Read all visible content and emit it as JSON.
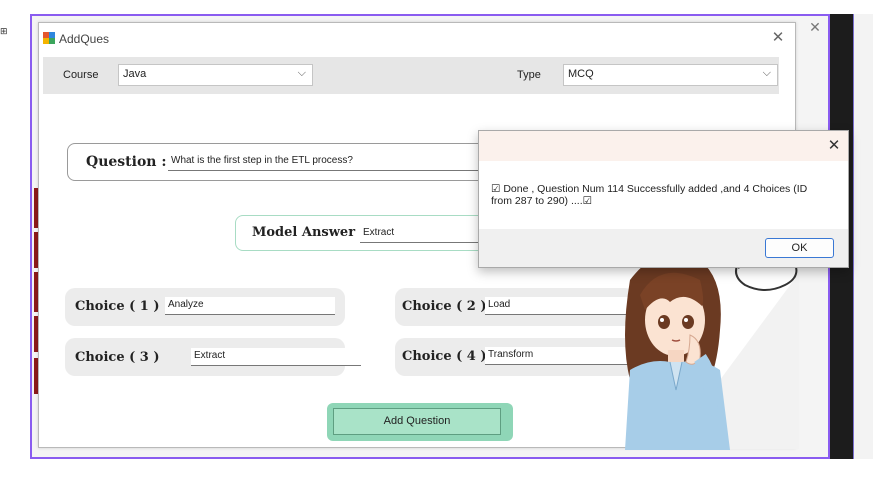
{
  "window": {
    "title": "AddQues",
    "close_glyph": "✕",
    "background_close_glyph": "✕"
  },
  "topbar": {
    "course_label": "Course",
    "course_value": "Java",
    "type_label": "Type",
    "type_value": "MCQ",
    "chevron": "⌵"
  },
  "question": {
    "label": "Question :",
    "value": "What is the first step in the ETL process?"
  },
  "model_answer": {
    "label": "Model Answer",
    "value": "Extract"
  },
  "choices": [
    {
      "label": "Choice ( 1 )",
      "value": "Analyze"
    },
    {
      "label": "Choice ( 2 )",
      "value": "Load"
    },
    {
      "label": "Choice ( 3 )",
      "value": "Extract"
    },
    {
      "label": "Choice ( 4 )",
      "value": "Transform"
    }
  ],
  "add_button": {
    "label": "Add Question"
  },
  "message_box": {
    "close_glyph": "✕",
    "text": "☑ Done , Question Num  114 Successfully added ,and 4 Choices (ID from 287 to 290) ....☑",
    "ok_label": "OK"
  },
  "colors": {
    "accent_purple": "#8a5cf0",
    "button_green": "#a9e3c8",
    "ok_border_blue": "#3a78d4",
    "red_accent": "#8b1a1a"
  },
  "icons": {
    "app_icon": "app-icon",
    "character": "anime-character-illustration"
  }
}
